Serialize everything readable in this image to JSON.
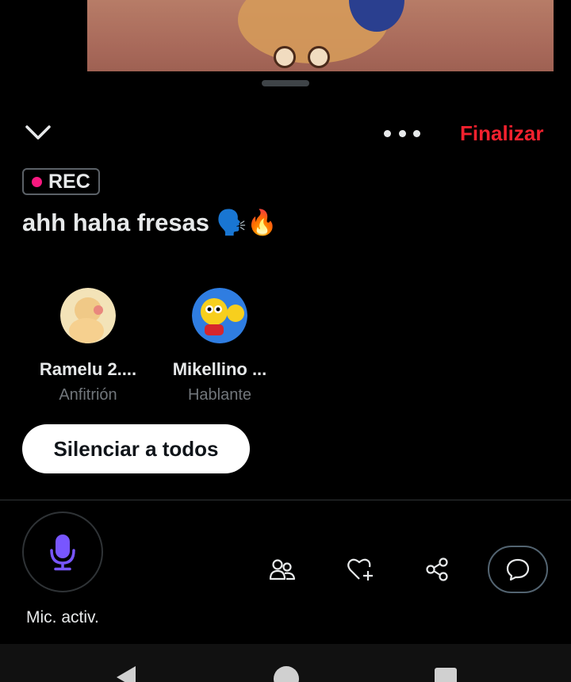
{
  "header": {
    "end_label": "Finalizar",
    "finalize_color": "#f4212e"
  },
  "space": {
    "rec_label": "REC",
    "title": "ahh haha fresas 🗣️🔥"
  },
  "participants": [
    {
      "name": "Ramelu 2....",
      "role": "Anfitrión"
    },
    {
      "name": "Mikellino ...",
      "role": "Hablante"
    }
  ],
  "controls": {
    "mute_all_label": "Silenciar a todos",
    "mic_label": "Mic. activ.",
    "mic_color": "#7856ff"
  },
  "icons": {
    "collapse": "chevron-down-icon",
    "more": "more-horizontal-icon",
    "people": "people-icon",
    "like": "heart-plus-icon",
    "share": "share-icon",
    "comment": "chat-bubble-icon"
  }
}
